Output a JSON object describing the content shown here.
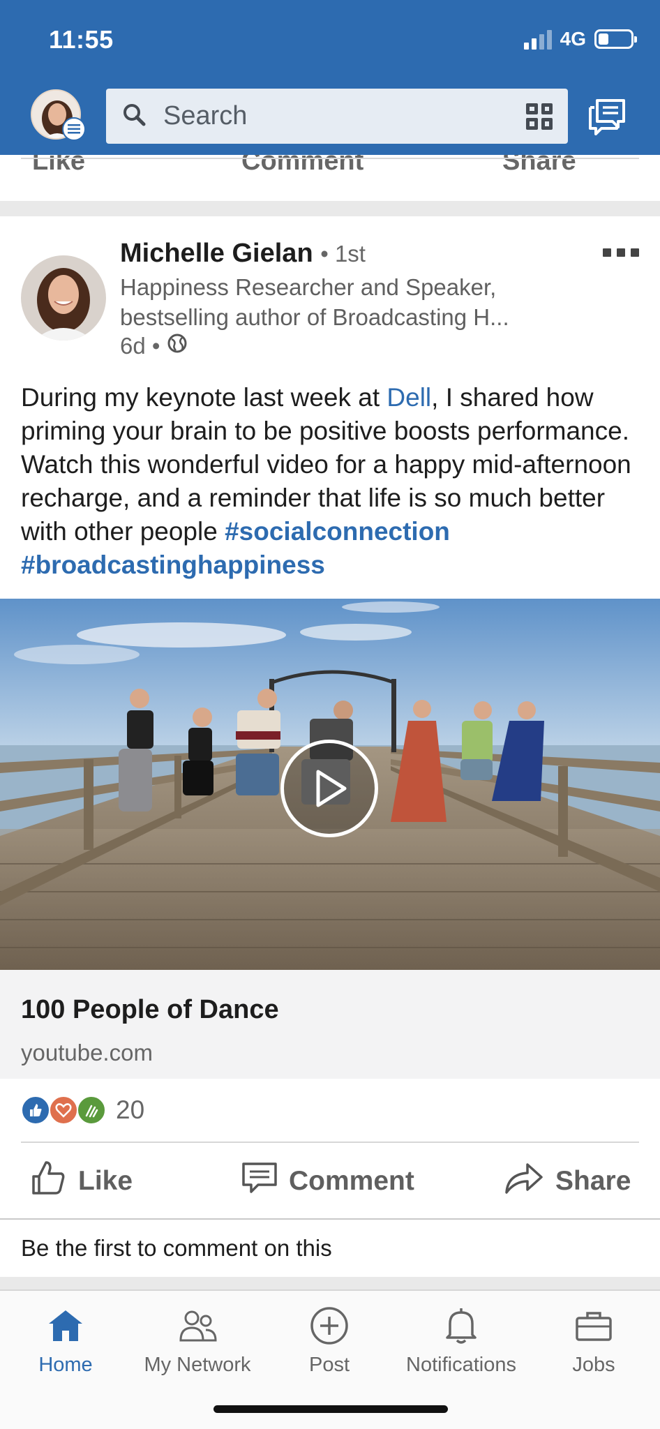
{
  "status_bar": {
    "time": "11:55",
    "network": "4G"
  },
  "header": {
    "search_placeholder": "Search",
    "icons": [
      "profile-avatar",
      "search-icon",
      "qr-code-icon",
      "messaging-icon"
    ]
  },
  "previous_post": {
    "actions": [
      "Like",
      "Comment",
      "Share"
    ]
  },
  "post": {
    "author_name": "Michelle Gielan",
    "degree": "• 1st",
    "headline": "Happiness Researcher and Speaker, bestselling author of Broadcasting H...",
    "time": "6d •",
    "text_before_link": "During my keynote last week at ",
    "link_text": "Dell",
    "text_after_link": ", I shared how priming your brain to be positive boosts performance. Watch this wonderful video for a happy mid-afternoon recharge, and a reminder that life is so much better with other people ",
    "hashtags": [
      "#socialconnection",
      "#broadcastinghappiness"
    ],
    "video": {
      "title": "100 People of Dance",
      "domain": "youtube.com"
    },
    "reactions": {
      "count": "20",
      "types": [
        "like",
        "love",
        "celebrate"
      ]
    },
    "actions": {
      "like": "Like",
      "comment": "Comment",
      "share": "Share"
    },
    "first_comment_prompt": "Be the first to comment on this"
  },
  "bottom_nav": {
    "items": [
      {
        "label": "Home",
        "icon": "home-icon",
        "active": true
      },
      {
        "label": "My Network",
        "icon": "network-icon",
        "active": false
      },
      {
        "label": "Post",
        "icon": "post-plus-icon",
        "active": false
      },
      {
        "label": "Notifications",
        "icon": "bell-icon",
        "active": false
      },
      {
        "label": "Jobs",
        "icon": "briefcase-icon",
        "active": false
      }
    ]
  },
  "colors": {
    "brand_blue": "#2d6bb0",
    "link_blue": "#2d6bb0",
    "text_dark": "#1d1d1d",
    "text_muted": "#666666"
  }
}
